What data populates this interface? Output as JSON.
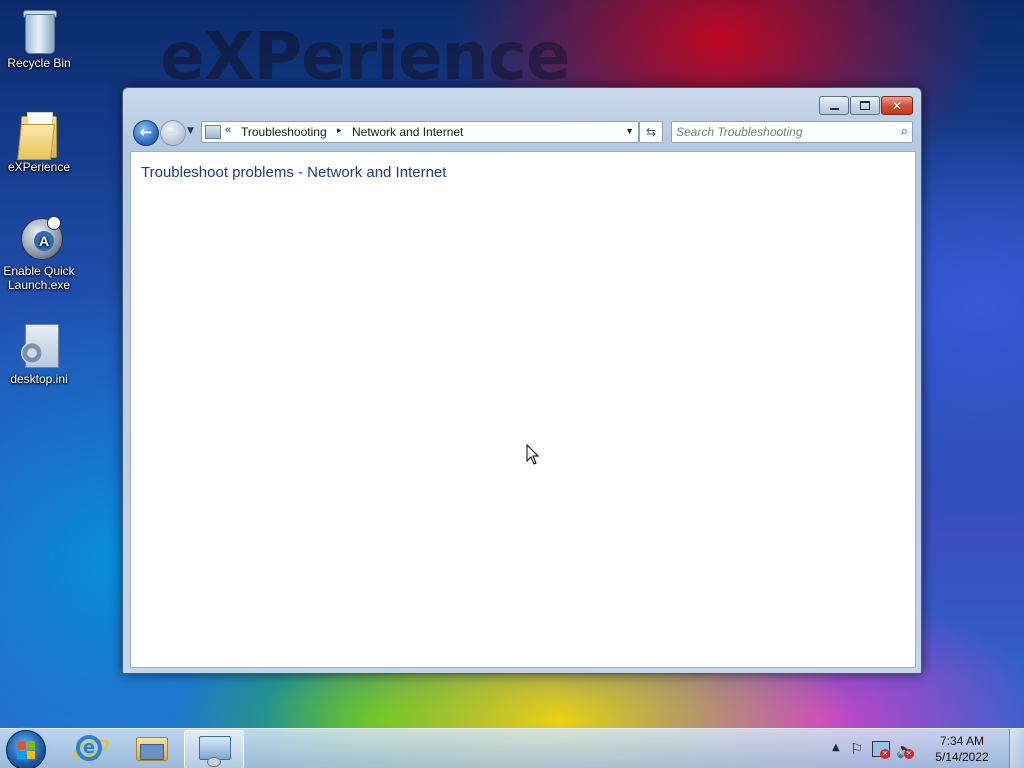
{
  "desktop": {
    "wallpaper_text": "eXPerience",
    "icons": [
      {
        "label": "Recycle Bin",
        "icon": "recycle-bin-icon"
      },
      {
        "label": "eXPerience",
        "icon": "folder-icon"
      },
      {
        "label": "Enable Quick Launch.exe",
        "icon": "app-icon"
      },
      {
        "label": "desktop.ini",
        "icon": "ini-file-icon"
      }
    ]
  },
  "window": {
    "caption": {
      "minimize": "minimize-icon",
      "maximize": "maximize-icon",
      "close": "close-icon"
    },
    "address": {
      "overflow": "«",
      "crumbs": [
        "Troubleshooting",
        "Network and Internet"
      ],
      "separator": "▸"
    },
    "search": {
      "placeholder": "Search Troubleshooting",
      "value": ""
    },
    "content": {
      "title": "Troubleshoot problems - Network and Internet"
    }
  },
  "taskbar": {
    "pinned": [
      "internet-explorer-icon",
      "windows-explorer-icon",
      "control-panel-icon"
    ],
    "active": "control-panel-icon",
    "tray": {
      "time": "7:34 AM",
      "date": "5/14/2022"
    }
  },
  "colors": {
    "link_blue": "#1e3a8c",
    "close_red": "#c03a22",
    "taskbar": "#b4c9e0"
  }
}
